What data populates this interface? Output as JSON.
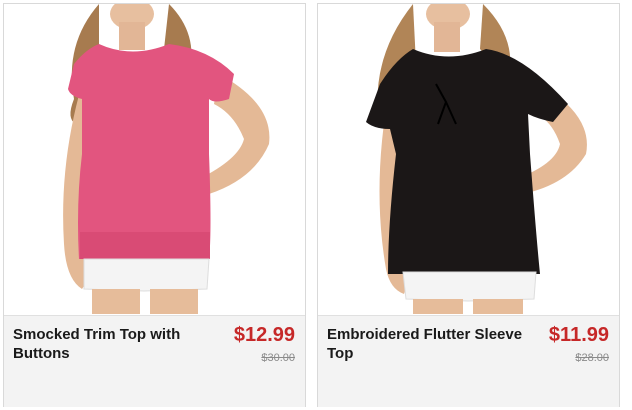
{
  "products": [
    {
      "title": "Smocked Trim Top with Buttons",
      "price": "$12.99",
      "original_price": "$30.00",
      "image_icon": "pink-smocked-top-photo",
      "garment_color": "#e2557f"
    },
    {
      "title": "Embroidered Flutter Sleeve Top",
      "price": "$11.99",
      "original_price": "$28.00",
      "image_icon": "black-flutter-top-photo",
      "garment_color": "#1b1717"
    }
  ],
  "colors": {
    "price": "#c62828",
    "info_background": "#f3f3f3"
  }
}
